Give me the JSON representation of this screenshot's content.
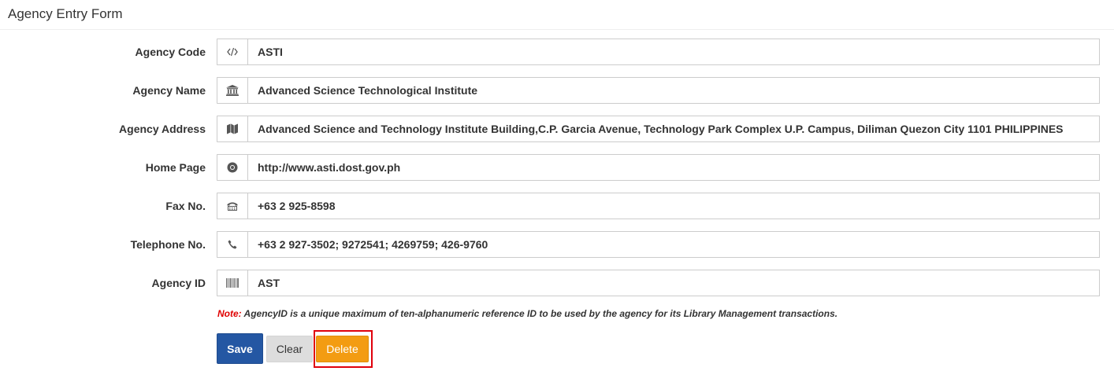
{
  "header": {
    "title": "Agency Entry Form"
  },
  "form": {
    "fields": [
      {
        "label": "Agency Code",
        "value": "ASTI",
        "icon": "code-icon"
      },
      {
        "label": "Agency Name",
        "value": "Advanced Science Technological Institute",
        "icon": "institution-icon"
      },
      {
        "label": "Agency Address",
        "value": "Advanced Science and Technology Institute Building,C.P. Garcia Avenue, Technology Park Complex U.P. Campus, Diliman Quezon City 1101 PHILIPPINES",
        "icon": "map-icon"
      },
      {
        "label": "Home Page",
        "value": "http://www.asti.dost.gov.ph",
        "icon": "chrome-icon"
      },
      {
        "label": "Fax No.",
        "value": "+63 2 925-8598",
        "icon": "fax-icon"
      },
      {
        "label": "Telephone No.",
        "value": "+63 2 927-3502; 9272541; 4269759; 426-9760",
        "icon": "phone-icon"
      },
      {
        "label": "Agency ID",
        "value": "AST",
        "icon": "barcode-icon"
      }
    ],
    "note": {
      "prefix": "Note:",
      "text": " AgencyID is a unique maximum of ten-alphanumeric reference ID to be used by the agency for its Library Management transactions."
    },
    "buttons": {
      "save": "Save",
      "clear": "Clear",
      "delete": "Delete"
    }
  },
  "colors": {
    "save": "#2457a3",
    "clear": "#dddddd",
    "delete": "#f39c12",
    "highlight": "#e0000b",
    "note_prefix": "#e00000"
  }
}
